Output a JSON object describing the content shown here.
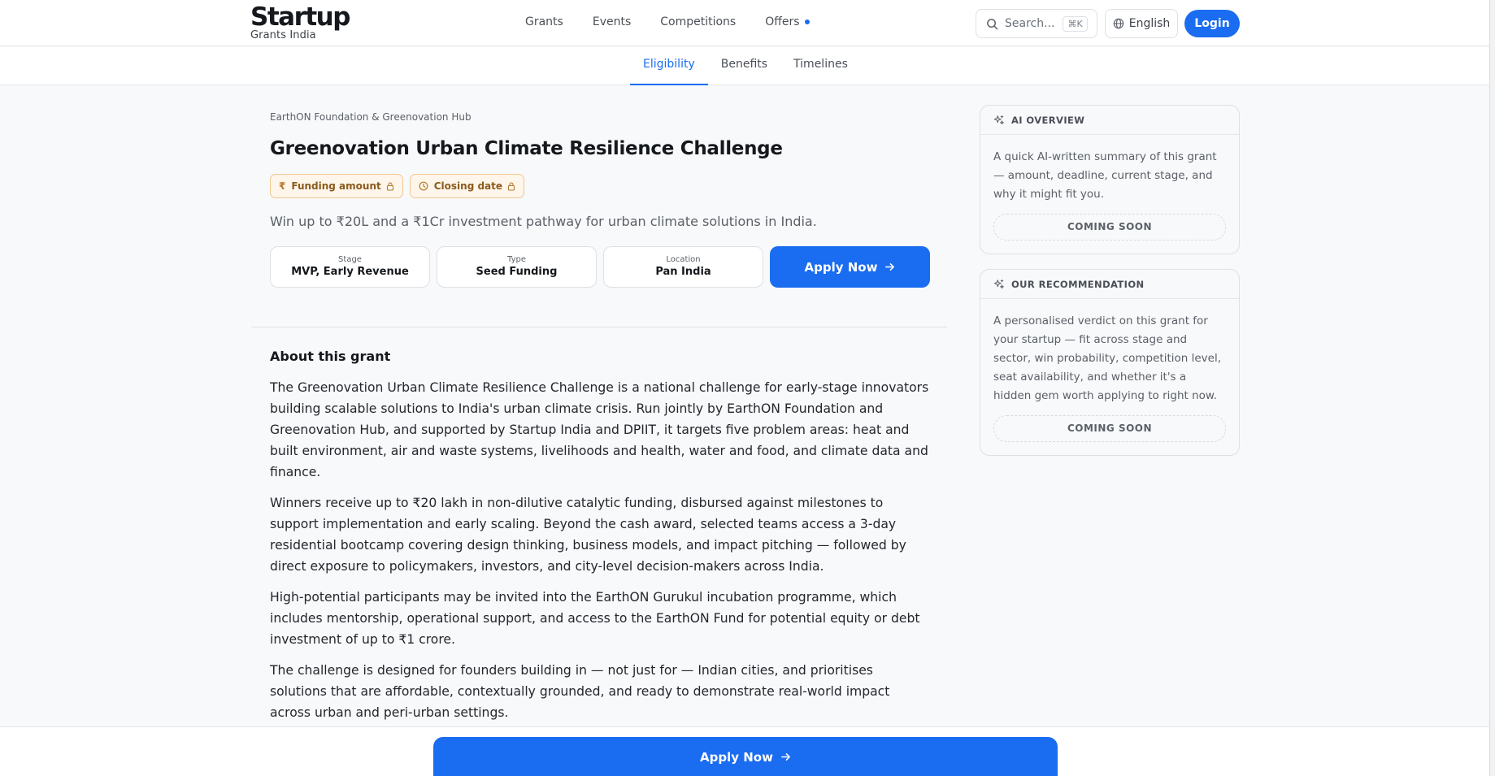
{
  "header": {
    "logo_main": "Startup",
    "logo_sub": "Grants India",
    "nav": [
      "Grants",
      "Events",
      "Competitions",
      "Offers"
    ],
    "search_placeholder": "Search...",
    "search_shortcut": "⌘K",
    "language": "English",
    "login_label": "Login"
  },
  "tabs": [
    "Eligibility",
    "Benefits",
    "Timelines"
  ],
  "grant": {
    "org": "EarthON Foundation & Greenovation Hub",
    "title": "Greenovation Urban Climate Resilience Challenge",
    "pill_funding": "Funding amount",
    "pill_closing": "Closing date",
    "tagline": "Win up to ₹20L and a ₹1Cr investment pathway for urban climate solutions in India.",
    "stats": [
      {
        "label": "Stage",
        "value": "MVP, Early Revenue"
      },
      {
        "label": "Type",
        "value": "Seed Funding"
      },
      {
        "label": "Location",
        "value": "Pan India"
      }
    ],
    "apply_label": "Apply Now"
  },
  "about": {
    "heading": "About this grant",
    "paragraphs": [
      "The Greenovation Urban Climate Resilience Challenge is a national challenge for early-stage innovators building scalable solutions to India's urban climate crisis. Run jointly by EarthON Foundation and Greenovation Hub, and supported by Startup India and DPIIT, it targets five problem areas: heat and built environment, air and waste systems, livelihoods and health, water and food, and climate data and finance.",
      "Winners receive up to ₹20 lakh in non-dilutive catalytic funding, disbursed against milestones to support implementation and early scaling. Beyond the cash award, selected teams access a 3-day residential bootcamp covering design thinking, business models, and impact pitching — followed by direct exposure to policymakers, investors, and city-level decision-makers across India.",
      "High-potential participants may be invited into the EarthON Gurukul incubation programme, which includes mentorship, operational support, and access to the EarthON Fund for potential equity or debt investment of up to ₹1 crore.",
      "The challenge is designed for founders building in — not just for — Indian cities, and prioritises solutions that are affordable, contextually grounded, and ready to demonstrate real-world impact across urban and peri-urban settings."
    ]
  },
  "sidebar": {
    "ai": {
      "heading": "AI OVERVIEW",
      "body": "A quick AI-written summary of this grant — amount, deadline, current stage, and why it might fit you.",
      "badge": "COMING SOON"
    },
    "rec": {
      "heading": "OUR RECOMMENDATION",
      "body": "A personalised verdict on this grant for your startup — fit across stage and sector, win probability, competition level, seat availability, and whether it's a hidden gem worth applying to right now.",
      "badge": "COMING SOON"
    }
  },
  "bottom": {
    "apply_label": "Apply Now"
  },
  "colors": {
    "accent": "#1a6cf0",
    "pill_bg": "#fef6ea",
    "pill_text": "#8a5a1c"
  }
}
